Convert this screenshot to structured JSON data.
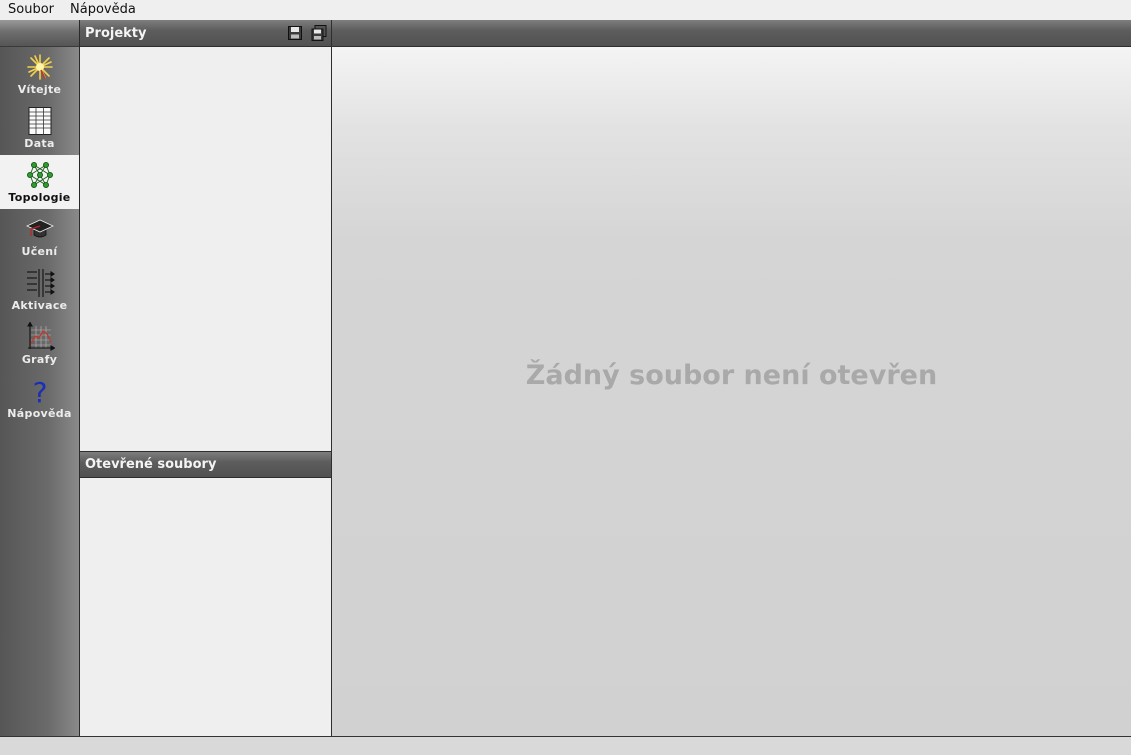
{
  "menu": {
    "file": "Soubor",
    "help": "Nápověda"
  },
  "sidebar": {
    "active": "topology",
    "items": [
      {
        "key": "welcome",
        "label": "Vítejte",
        "icon": "starburst-icon"
      },
      {
        "key": "data",
        "label": "Data",
        "icon": "spreadsheet-icon"
      },
      {
        "key": "topology",
        "label": "Topologie",
        "icon": "network-topology-icon"
      },
      {
        "key": "learning",
        "label": "Učení",
        "icon": "graduation-cap-icon"
      },
      {
        "key": "activation",
        "label": "Aktivace",
        "icon": "activation-arrows-icon"
      },
      {
        "key": "graphs",
        "label": "Grafy",
        "icon": "line-graph-icon"
      },
      {
        "key": "help",
        "label": "Nápověda",
        "icon": "question-mark-icon"
      }
    ]
  },
  "projects_panel": {
    "title": "Projekty",
    "buttons": [
      "save-icon",
      "save-all-icon"
    ]
  },
  "open_files_panel": {
    "title": "Otevřené soubory"
  },
  "main": {
    "empty_message": "Žádný soubor není otevřen"
  },
  "colors": {
    "sidebar_bg": "#6a6a6a",
    "header_bg": "#5d5d5d",
    "panel_bg": "#efefef",
    "main_bg": "#d1d1d1",
    "placeholder_text": "#a9a9a9"
  }
}
